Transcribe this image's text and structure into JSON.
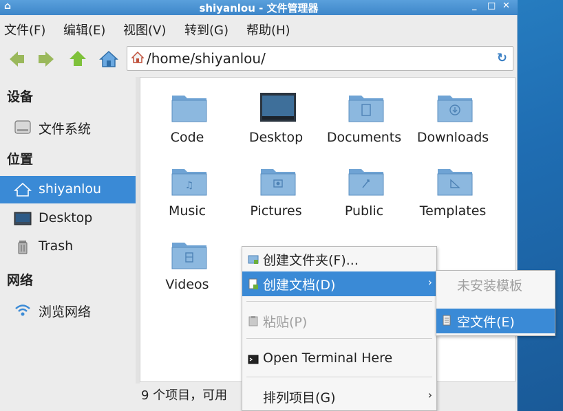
{
  "window": {
    "title": "shiyanlou - 文件管理器",
    "controls": {
      "minimize": "_",
      "maximize": "□",
      "close": "✕"
    },
    "app_icon": "home-icon"
  },
  "menubar": {
    "file": "文件(F)",
    "edit": "编辑(E)",
    "view": "视图(V)",
    "go": "转到(G)",
    "help": "帮助(H)"
  },
  "toolbar": {
    "back_icon": "back-arrow-icon",
    "forward_icon": "forward-arrow-icon",
    "up_icon": "up-arrow-icon",
    "home_icon": "home-icon",
    "location": "/home/shiyanlou/",
    "reload_icon": "reload-icon"
  },
  "sidebar": {
    "devices_header": "设备",
    "places_header": "位置",
    "network_header": "网络",
    "devices": [
      {
        "label": "文件系统",
        "icon": "drive-icon"
      }
    ],
    "places": [
      {
        "label": "shiyanlou",
        "icon": "home-folder-icon",
        "selected": true
      },
      {
        "label": "Desktop",
        "icon": "desktop-icon",
        "selected": false
      },
      {
        "label": "Trash",
        "icon": "trash-icon",
        "selected": false
      }
    ],
    "network": [
      {
        "label": "浏览网络",
        "icon": "wifi-icon"
      }
    ]
  },
  "files": [
    {
      "name": "Code",
      "glyph": ""
    },
    {
      "name": "Desktop",
      "glyph": ""
    },
    {
      "name": "Documents",
      "glyph": "🗋"
    },
    {
      "name": "Downloads",
      "glyph": "⊕"
    },
    {
      "name": "Music",
      "glyph": "♫"
    },
    {
      "name": "Pictures",
      "glyph": "◘"
    },
    {
      "name": "Public",
      "glyph": "⚲"
    },
    {
      "name": "Templates",
      "glyph": "◺"
    },
    {
      "name": "Videos",
      "glyph": "▤"
    }
  ],
  "statusbar": {
    "text": "9 个项目，可用"
  },
  "context_menu": {
    "items": [
      {
        "label": "创建文件夹(F)...",
        "icon": "new-folder-icon"
      },
      {
        "label": "创建文档(D)",
        "icon": "new-document-icon",
        "has_submenu": true,
        "highlighted": true
      },
      {
        "label": "粘贴(P)",
        "icon": "paste-icon",
        "disabled": true
      },
      {
        "label": "Open Terminal Here",
        "icon": "terminal-icon"
      },
      {
        "label": "排列项目(G)",
        "has_submenu": true
      }
    ],
    "submenu_arrow": "›"
  },
  "submenu": {
    "items": [
      {
        "label": "未安装模板",
        "disabled": true
      },
      {
        "label": "空文件(E)",
        "icon": "empty-file-icon",
        "highlighted": true
      }
    ]
  },
  "colors": {
    "selection": "#3a8ad6",
    "titlebar": "#4a93d4",
    "folder": "#8cb8df"
  }
}
